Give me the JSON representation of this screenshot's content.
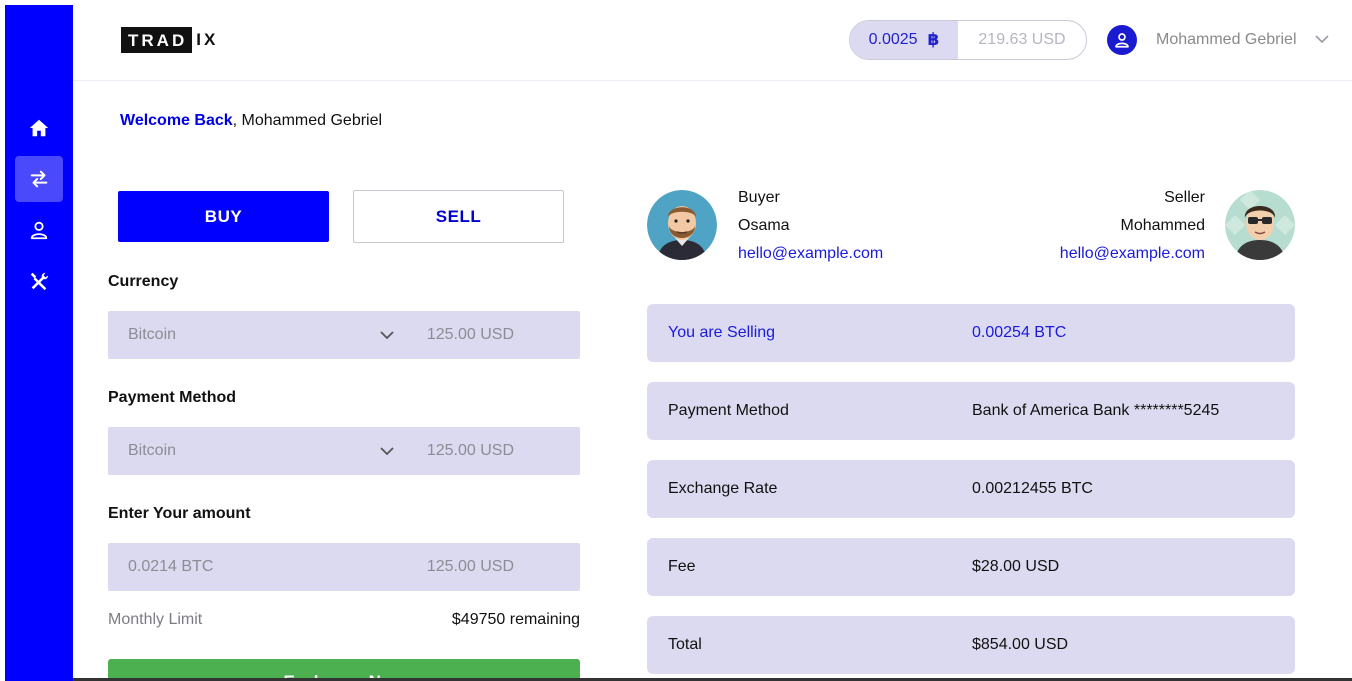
{
  "brand": {
    "logo_box": "TRAD",
    "logo_tail": "IX"
  },
  "header": {
    "balance_btc": "0.0025",
    "btc_symbol": "฿",
    "balance_usd": "219.63 USD",
    "user_name": "Mohammed Gebriel"
  },
  "sidebar": {
    "items": [
      {
        "icon": "home-icon",
        "active": false
      },
      {
        "icon": "exchange-arrows-icon",
        "active": true
      },
      {
        "icon": "user-icon",
        "active": false
      },
      {
        "icon": "tools-icon",
        "active": false
      }
    ]
  },
  "welcome": {
    "greeting": "Welcome Back",
    "rest": ", Mohammed Gebriel"
  },
  "trade": {
    "buy_label": "BUY",
    "sell_label": "SELL",
    "currency_label": "Currency",
    "currency_value": "Bitcoin",
    "currency_usd": "125.00 USD",
    "payment_label": "Payment Method",
    "payment_value": "Bitcoin",
    "payment_usd": "125.00 USD",
    "amount_label": "Enter Your amount",
    "amount_btc": "0.0214 BTC",
    "amount_usd": "125.00 USD",
    "limit_label": "Monthly Limit",
    "limit_value": "$49750 remaining",
    "exchange_label": "Exchange Now"
  },
  "buyer": {
    "role": "Buyer",
    "name": "Osama",
    "email": "hello@example.com"
  },
  "seller": {
    "role": "Seller",
    "name": "Mohammed",
    "email": "hello@example.com"
  },
  "summary": [
    {
      "key": "You are Selling",
      "value": "0.00254 BTC"
    },
    {
      "key": "Payment Method",
      "value": "Bank of America Bank ********5245"
    },
    {
      "key": "Exchange Rate",
      "value": "0.00212455 BTC"
    },
    {
      "key": "Fee",
      "value": "$28.00 USD"
    },
    {
      "key": "Total",
      "value": "$854.00 USD"
    }
  ],
  "colors": {
    "primary": "#0000fe",
    "field_bg": "#dcdaf0",
    "success": "#4caf50",
    "link": "#1a1adb"
  }
}
